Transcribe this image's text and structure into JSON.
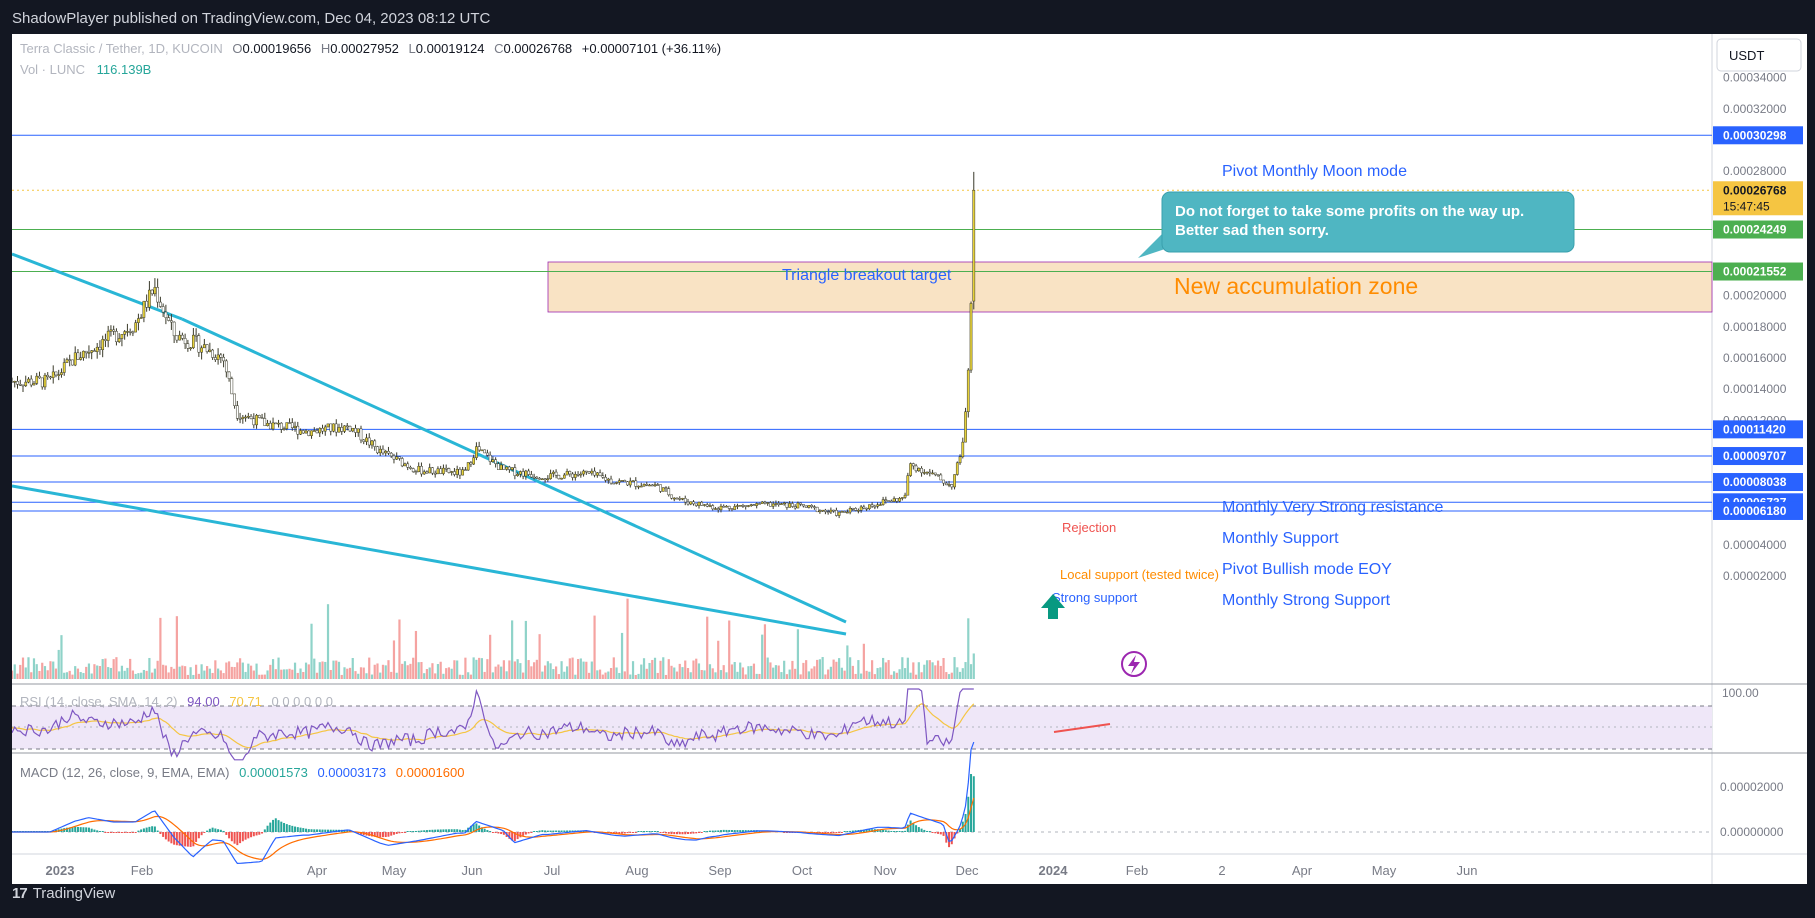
{
  "header": {
    "published": "ShadowPlayer published on TradingView.com, Dec 04, 2023 08:12 UTC"
  },
  "footer": {
    "brand": "TradingView"
  },
  "legend": {
    "symbol": "Terra Classic / Tether, 1D, KUCOIN",
    "o_label": "O",
    "o": "0.00019656",
    "h_label": "H",
    "h": "0.00027952",
    "l_label": "L",
    "l": "0.00019124",
    "c_label": "C",
    "c": "0.00026768",
    "change": "+0.00007101 (+36.11%)",
    "vol_label": "Vol · LUNC",
    "vol": "116.139B"
  },
  "currency_button": "USDT",
  "countdown": "15:47:45",
  "colors": {
    "bg": "#ffffff",
    "up": "#26a69a",
    "down": "#ef5350",
    "candle": "#e6d13a",
    "hline_blue": "#2962ff",
    "hline_green": "#4caf50",
    "zone": "#f9e3c4",
    "wedge": "#29b6d6",
    "accent_orange": "#ff8c00",
    "rsi": "#7e57c2",
    "rsi_ma": "#f5c542",
    "macd": "#2962ff",
    "signal": "#ff6d00"
  },
  "price_axis": {
    "ticks": [
      "0.00034000",
      "0.00032000",
      "0.00028000",
      "0.00020000",
      "0.00018000",
      "0.00016000",
      "0.00014000",
      "0.00012000",
      "0.00004000",
      "0.00002000"
    ]
  },
  "price_labels": [
    {
      "text": "0.00030298",
      "value": 0.00030298,
      "color": "#2962ff"
    },
    {
      "text": "0.00026768",
      "value": 0.00026768,
      "color": "#f5c542"
    },
    {
      "text": "0.00024249",
      "value": 0.00024249,
      "color": "#4caf50"
    },
    {
      "text": "0.00021552",
      "value": 0.00021552,
      "color": "#4caf50"
    },
    {
      "text": "0.00011420",
      "value": 0.0001142,
      "color": "#2962ff"
    },
    {
      "text": "0.00009707",
      "value": 9.707e-05,
      "color": "#2962ff"
    },
    {
      "text": "0.00008038",
      "value": 8.038e-05,
      "color": "#2962ff"
    },
    {
      "text": "0.00006737",
      "value": 6.737e-05,
      "color": "#2962ff"
    },
    {
      "text": "0.00006180",
      "value": 6.18e-05,
      "color": "#2962ff"
    }
  ],
  "annotations": {
    "pivot_moon": "Pivot Monthly Moon mode",
    "callout_line1": "Do not forget to take some profits on the way up.",
    "callout_line2": "Better sad then sorry.",
    "triangle_target": "Triangle breakout target",
    "accumulation": "New accumulation zone",
    "very_strong_res": "Monthly Very Strong resistance",
    "monthly_support": "Monthly Support",
    "pivot_bullish": "Pivot Bullish mode EOY",
    "monthly_strong_support": "Monthly Strong Support",
    "rejection": "Rejection",
    "local_support": "Local support (tested twice)",
    "strong_support": "Strong support"
  },
  "rsi": {
    "title": "RSI (14, close, SMA, 14, 2)",
    "v1": "94.00",
    "v2": "70.71",
    "rest": "0 0 0 0 0 0",
    "top_tick": "100.00"
  },
  "macd": {
    "title": "MACD (12, 26, close, 9, EMA, EMA)",
    "hist": "0.00001573",
    "macd": "0.00003173",
    "signal": "0.00001600",
    "ticks": [
      "0.00002000",
      "0.00000000"
    ]
  },
  "time_axis": [
    "2023",
    "Feb",
    "Apr",
    "May",
    "Jun",
    "Jul",
    "Aug",
    "Sep",
    "Oct",
    "Nov",
    "Dec",
    "2024",
    "Feb",
    "2",
    "Apr",
    "May",
    "Jun"
  ],
  "chart_data": {
    "type": "candlestick",
    "title": "Terra Classic / Tether, 1D, KUCOIN",
    "ylabel": "USDT",
    "ylim": [
      8.5e-06,
      0.000368
    ],
    "x_ticks": [
      "2023",
      "Feb",
      "Apr",
      "May",
      "Jun",
      "Jul",
      "Aug",
      "Sep",
      "Oct",
      "Nov",
      "Dec",
      "2024",
      "Feb",
      "2",
      "Apr",
      "May",
      "Jun"
    ],
    "close_path": [
      [
        "2023-01-01",
        0.000145
      ],
      [
        "2023-01-10",
        0.00016
      ],
      [
        "2023-01-20",
        0.00017
      ],
      [
        "2023-02-01",
        0.000182
      ],
      [
        "2023-02-08",
        0.000205
      ],
      [
        "2023-02-15",
        0.000175
      ],
      [
        "2023-02-25",
        0.000168
      ],
      [
        "2023-03-05",
        0.00016
      ],
      [
        "2023-03-10",
        0.000125
      ],
      [
        "2023-03-20",
        0.000118
      ],
      [
        "2023-04-05",
        0.000113
      ],
      [
        "2023-04-20",
        0.000116
      ],
      [
        "2023-05-01",
        0.0001
      ],
      [
        "2023-05-15",
        8.8e-05
      ],
      [
        "2023-06-01",
        8.6e-05
      ],
      [
        "2023-06-05",
        0.000102
      ],
      [
        "2023-06-15",
        8.8e-05
      ],
      [
        "2023-07-01",
        8.4e-05
      ],
      [
        "2023-07-15",
        8.6e-05
      ],
      [
        "2023-07-25",
        8.1e-05
      ],
      [
        "2023-08-10",
        7.8e-05
      ],
      [
        "2023-08-15",
        7.2e-05
      ],
      [
        "2023-08-20",
        6.8e-05
      ],
      [
        "2023-09-01",
        6.4e-05
      ],
      [
        "2023-09-20",
        6.6e-05
      ],
      [
        "2023-10-01",
        6.5e-05
      ],
      [
        "2023-10-15",
        6e-05
      ],
      [
        "2023-11-01",
        6.8e-05
      ],
      [
        "2023-11-08",
        7e-05
      ],
      [
        "2023-11-10",
        9.2e-05
      ],
      [
        "2023-11-18",
        8.5e-05
      ],
      [
        "2023-11-25",
        7.8e-05
      ],
      [
        "2023-11-28",
        9.5e-05
      ],
      [
        "2023-11-30",
        0.000118
      ],
      [
        "2023-12-01",
        0.000145
      ],
      [
        "2023-12-02",
        0.0002
      ],
      [
        "2023-12-03",
        0.000197
      ],
      [
        "2023-12-04",
        0.00026768
      ]
    ],
    "last_candle": {
      "open": 0.00019656,
      "high": 0.00027952,
      "low": 0.00019124,
      "close": 0.00026768
    },
    "horizontal_levels": [
      0.00030298,
      0.00024249,
      0.00021552,
      0.0001142,
      9.707e-05,
      8.038e-05,
      6.737e-05,
      6.18e-05
    ],
    "zone": {
      "from": 0.00021552,
      "to": 0.00024249,
      "start": "2023-06-01"
    },
    "wedge_upper": [
      [
        "2022-12-10",
        0.000235
      ],
      [
        "2023-02-01",
        0.000205
      ],
      [
        "2023-09-01",
        6.2e-05
      ]
    ],
    "wedge_lower": [
      [
        "2022-12-10",
        0.00011
      ],
      [
        "2023-09-01",
        6e-05
      ]
    ],
    "volume_series": {
      "name": "Vol · LUNC",
      "last": "116.139B"
    },
    "rsi_last": [
      94.0,
      70.71
    ],
    "macd_last": {
      "hist": 1.573e-05,
      "macd": 3.173e-05,
      "signal": 1.6e-05
    },
    "grid": false
  }
}
